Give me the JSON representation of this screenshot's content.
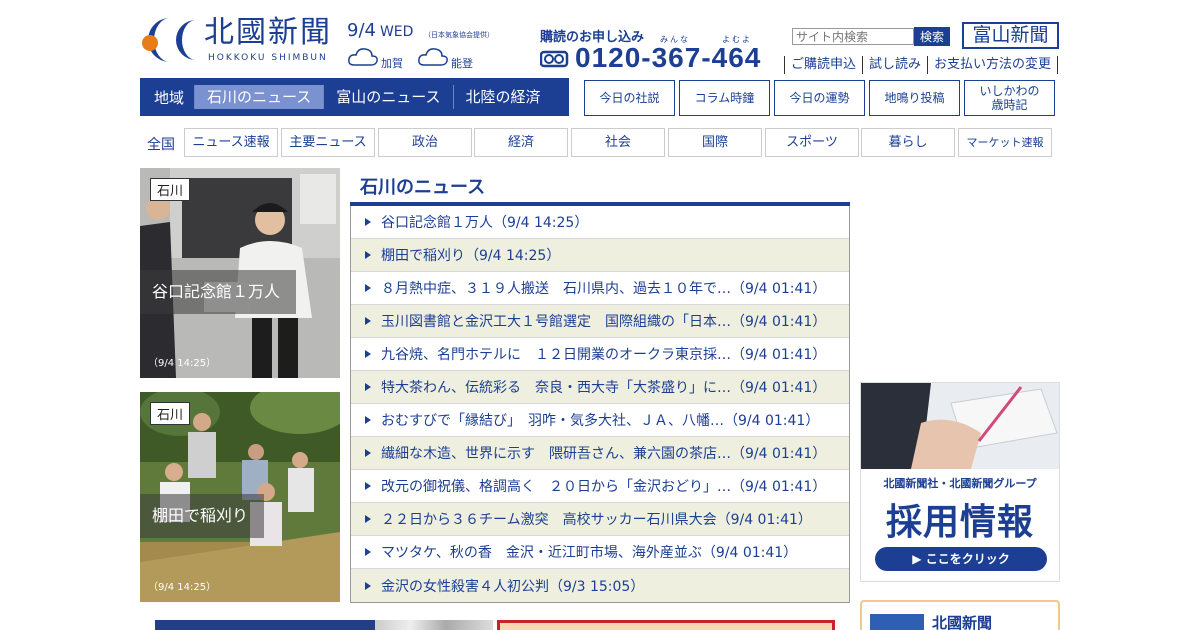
{
  "header": {
    "logo_text": "北國新聞",
    "logo_sub": "HOKKOKU SHIMBUN",
    "date": "9/4",
    "weekday": "WED",
    "weather_note": "（日本気象協会提供）",
    "weather": [
      {
        "place": "加賀",
        "icon": "cloud-icon"
      },
      {
        "place": "能登",
        "icon": "cloud-icon"
      }
    ],
    "subscribe_label": "購読のお申し込み",
    "ruby_1": "みんな",
    "ruby_2": "よむよ",
    "phone": "0120-367-464",
    "search_placeholder": "サイト内検索",
    "search_button": "検索",
    "toyama_logo": "富山新聞",
    "links": [
      "ご購読申込",
      "試し読み",
      "お支払い方法の変更"
    ]
  },
  "region_nav": {
    "label": "地域",
    "tabs": [
      {
        "label": "石川のニュース",
        "active": true
      },
      {
        "label": "富山のニュース",
        "active": false
      },
      {
        "label": "北陸の経済",
        "active": false
      }
    ]
  },
  "feature_buttons": [
    "今日の社説",
    "コラム時鐘",
    "今日の運勢",
    "地鳴り投稿",
    "いしかわの\n歳時記"
  ],
  "categories": {
    "all_label": "全国",
    "tabs": [
      "ニュース速報",
      "主要ニュース",
      "政治",
      "経済",
      "社会",
      "国際",
      "スポーツ",
      "暮らし",
      "マーケット速報"
    ]
  },
  "photo_cards": [
    {
      "tag": "石川",
      "caption": "谷口記念館１万人",
      "time": "（9/4 14:25）"
    },
    {
      "tag": "石川",
      "caption": "棚田で稲刈り",
      "time": "（9/4 14:25）"
    }
  ],
  "news": {
    "title": "石川のニュース",
    "items": [
      "谷口記念館１万人（9/4 14:25）",
      "棚田で稲刈り（9/4 14:25）",
      "８月熱中症、３１９人搬送　石川県内、過去１０年で…（9/4 01:41）",
      "玉川図書館と金沢工大１号館選定　国際組織の「日本…（9/4 01:41）",
      "九谷焼、名門ホテルに　１２日開業のオークラ東京採…（9/4 01:41）",
      "特大茶わん、伝統彩る　奈良・西大寺「大茶盛り」に…（9/4 01:41）",
      "おむすびで「縁結び」　羽咋・気多大社、ＪＡ、八幡…（9/4 01:41）",
      "繊細な木造、世界に示す　隈研吾さん、兼六園の茶店…（9/4 01:41）",
      "改元の御祝儀、格調高く　２０日から「金沢おどり」…（9/4 01:41）",
      "２２日から３６チーム激突　高校サッカー石川県大会（9/4 01:41）",
      "マツタケ、秋の香　金沢・近江町市場、海外産並ぶ（9/4 01:41）",
      "金沢の女性殺害４人初公判（9/3 15:05）"
    ]
  },
  "ads": {
    "recruit_line1": "北國新聞社・北國新聞グループ",
    "recruit_line2": "採用情報",
    "recruit_button": "▶ ここをクリック",
    "hokkoku_box": "北國新聞"
  },
  "colors": {
    "brand": "#1c3f93",
    "active_tab": "#7b92d0",
    "row_alt": "#efefdf"
  }
}
